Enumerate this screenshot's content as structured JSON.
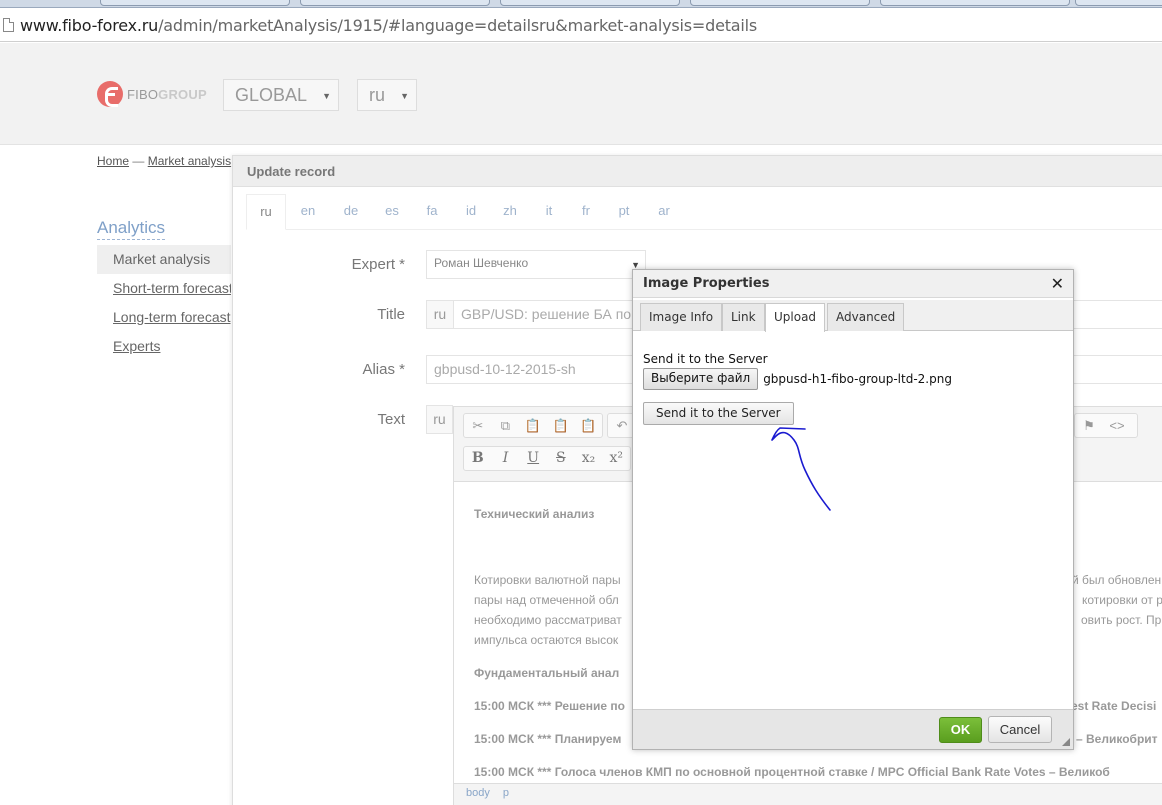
{
  "browser": {
    "url_host": "www.fibo-forex.ru",
    "url_path": "/admin/marketAnalysis/1915/#language=detailsru&market-analysis=details"
  },
  "header": {
    "logo_prefix": "FIBO",
    "logo_suffix": "GROUP",
    "region_select": "GLOBAL",
    "lang_select": "ru"
  },
  "breadcrumb": {
    "home": "Home",
    "separator": "—",
    "current": "Market analysis"
  },
  "sidebar": {
    "title": "Analytics",
    "items": [
      {
        "label": "Market analysis"
      },
      {
        "label": "Short-term forecast"
      },
      {
        "label": "Long-term forecast"
      },
      {
        "label": "Experts"
      }
    ]
  },
  "update_panel": {
    "title": "Update record",
    "lang_tabs": [
      "ru",
      "en",
      "de",
      "es",
      "fa",
      "id",
      "zh",
      "it",
      "fr",
      "pt",
      "ar"
    ],
    "expert_label": "Expert *",
    "expert_value": "Роман Шевченко",
    "title_label": "Title",
    "title_prefix": "ru",
    "title_value": "GBP/USD: решение БА по",
    "alias_label": "Alias *",
    "alias_value": "gbpusd-10-12-2015-sh",
    "text_label": "Text",
    "text_prefix": "ru"
  },
  "editor": {
    "heading1": "Технический анализ",
    "para_line1_left": "Котировки валютной пары",
    "para_line1_right": "й был обновлен",
    "para_line2_left": "пары над отмеченной обл",
    "para_line2_right": "котировки от ра",
    "para_line3_left": "необходимо рассматриват",
    "para_line3_right": "овить рост. Пр",
    "para_line4_left": "импульса остаются высок",
    "heading2": "Фундаментальный анал",
    "row1_left": "15:00 МСК *** Решение по",
    "row1_right": "est Rate Decisi",
    "row2_left": "15:00 МСК *** Планируем",
    "row2_right": "– Великобрит",
    "row3": "15:00 МСК *** Голоса членов КМП по основной процентной ставке / MPC Official Bank Rate Votes – Великоб",
    "status_body": "body",
    "status_p": "p"
  },
  "dialog": {
    "title": "Image Properties",
    "tabs": [
      "Image Info",
      "Link",
      "Upload",
      "Advanced"
    ],
    "active_tab": "Upload",
    "upload_label": "Send it to the Server",
    "choose_file": "Выберите файл",
    "file_name": "gbpusd-h1-fibo-group-ltd-2.png",
    "send_button": "Send it to the Server",
    "ok": "OK",
    "cancel": "Cancel"
  },
  "colors": {
    "accent_link": "#7fa0c8",
    "ok_green": "#6aae2c",
    "annotation": "#1a1ad0"
  }
}
